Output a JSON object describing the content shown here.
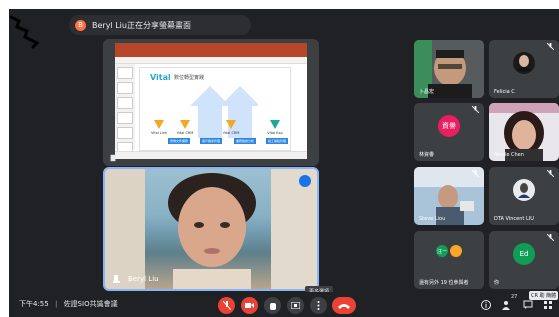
{
  "presenter_chip": {
    "initial": "B",
    "label": "Beryl Liu正在分享螢幕畫面"
  },
  "slide": {
    "brand": "Vital",
    "subtitle": "數位轉型實踐",
    "tri_labels": [
      "Vital Link",
      "Vital CRM",
      "Vital CRM",
      "Vital Exp"
    ],
    "box_labels": [
      "雲端文件服務",
      "客戶關係管理",
      "業務數據分析",
      "員工體驗管理"
    ]
  },
  "camera": {
    "name": "Beryl Liu",
    "tooltip": "更多選項"
  },
  "participants": [
    {
      "name": "卜昌宏",
      "type": "video"
    },
    {
      "name": "Felicia C",
      "type": "avatar-photo"
    },
    {
      "name": "林資譽",
      "type": "initial",
      "initial": "資譽",
      "color": "#e91e63"
    },
    {
      "name": "Nicole Chen",
      "type": "video"
    },
    {
      "name": "Steve Liou",
      "type": "video"
    },
    {
      "name": "DTA Vincent LIU",
      "type": "avatar-photo"
    },
    {
      "name": "還有另外 19 位參與者",
      "type": "group",
      "initial": "汪一"
    },
    {
      "name": "你",
      "type": "initial",
      "initial": "Ed",
      "color": "#0f9d58"
    }
  ],
  "bottom": {
    "clock": "下午4:55",
    "meeting_title": "佐證SIO共識會議",
    "participant_count": "27",
    "cc_badge": "CR 助 簡體"
  },
  "colors": {
    "stage": "#202124",
    "tile": "#3c4043",
    "danger": "#ea4335",
    "accent": "#8ab4f8"
  }
}
